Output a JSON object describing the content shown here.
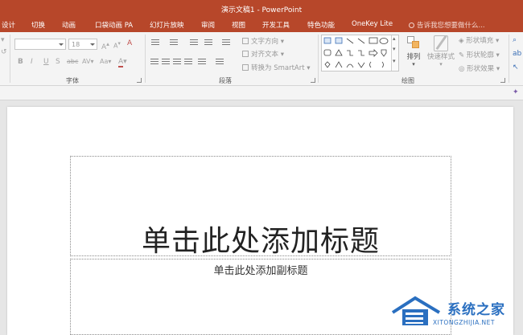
{
  "window": {
    "title": "演示文稿1 - PowerPoint"
  },
  "tabs": [
    {
      "label": "设计"
    },
    {
      "label": "切换"
    },
    {
      "label": "动画"
    },
    {
      "label": "口袋动画 PA"
    },
    {
      "label": "幻灯片放映"
    },
    {
      "label": "审阅"
    },
    {
      "label": "视图"
    },
    {
      "label": "开发工具"
    },
    {
      "label": "特色功能"
    },
    {
      "label": "OneKey Lite"
    }
  ],
  "tell_me": {
    "placeholder": "告诉我您想要做什么..."
  },
  "ribbon": {
    "font_group": {
      "label": "字体",
      "font_size": "18",
      "bold": "B",
      "italic": "I",
      "underline": "U",
      "shadow": "S",
      "strike": "abc",
      "spacing": "AV",
      "case": "Aa",
      "grow": "A",
      "shrink": "A",
      "clear": "A"
    },
    "paragraph_group": {
      "label": "段落",
      "text_direction": "文字方向",
      "align_text": "对齐文本",
      "convert_smartart": "转换为 SmartArt"
    },
    "drawing_group": {
      "label": "绘图",
      "arrange": "排列",
      "quick_styles": "快速样式",
      "shape_fill": "形状填充",
      "shape_outline": "形状轮廓",
      "shape_effects": "形状效果"
    }
  },
  "slide": {
    "title_placeholder": "单击此处添加标题",
    "subtitle_placeholder": "单击此处添加副标题"
  },
  "watermark": {
    "name": "系统之家",
    "url": "XITONGZHIJIA.NET"
  },
  "colors": {
    "accent": "#b7472a",
    "ribbon_bg": "#f4f4f4",
    "workspace": "#e6e6e6"
  }
}
